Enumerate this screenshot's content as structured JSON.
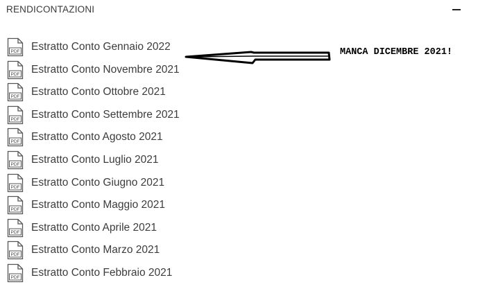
{
  "section": {
    "title": "RENDICONTAZIONI",
    "toggle_icon": "minus-icon"
  },
  "documents": [
    {
      "label": "Estratto Conto Gennaio 2022",
      "icon": "pdf-file-icon"
    },
    {
      "label": "Estratto Conto Novembre 2021",
      "icon": "pdf-file-icon"
    },
    {
      "label": "Estratto Conto Ottobre 2021",
      "icon": "pdf-file-icon"
    },
    {
      "label": "Estratto Conto Settembre 2021",
      "icon": "pdf-file-icon"
    },
    {
      "label": "Estratto Conto Agosto 2021",
      "icon": "pdf-file-icon"
    },
    {
      "label": "Estratto Conto Luglio 2021",
      "icon": "pdf-file-icon"
    },
    {
      "label": "Estratto Conto Giugno 2021",
      "icon": "pdf-file-icon"
    },
    {
      "label": "Estratto Conto Maggio 2021",
      "icon": "pdf-file-icon"
    },
    {
      "label": "Estratto Conto Aprile 2021",
      "icon": "pdf-file-icon"
    },
    {
      "label": "Estratto Conto Marzo 2021",
      "icon": "pdf-file-icon"
    },
    {
      "label": "Estratto Conto Febbraio 2021",
      "icon": "pdf-file-icon"
    }
  ],
  "pdf_icon_text": "PDF",
  "annotation": {
    "text": "MANCA DICEMBRE 2021!",
    "icon": "hand-drawn-arrow-icon"
  }
}
